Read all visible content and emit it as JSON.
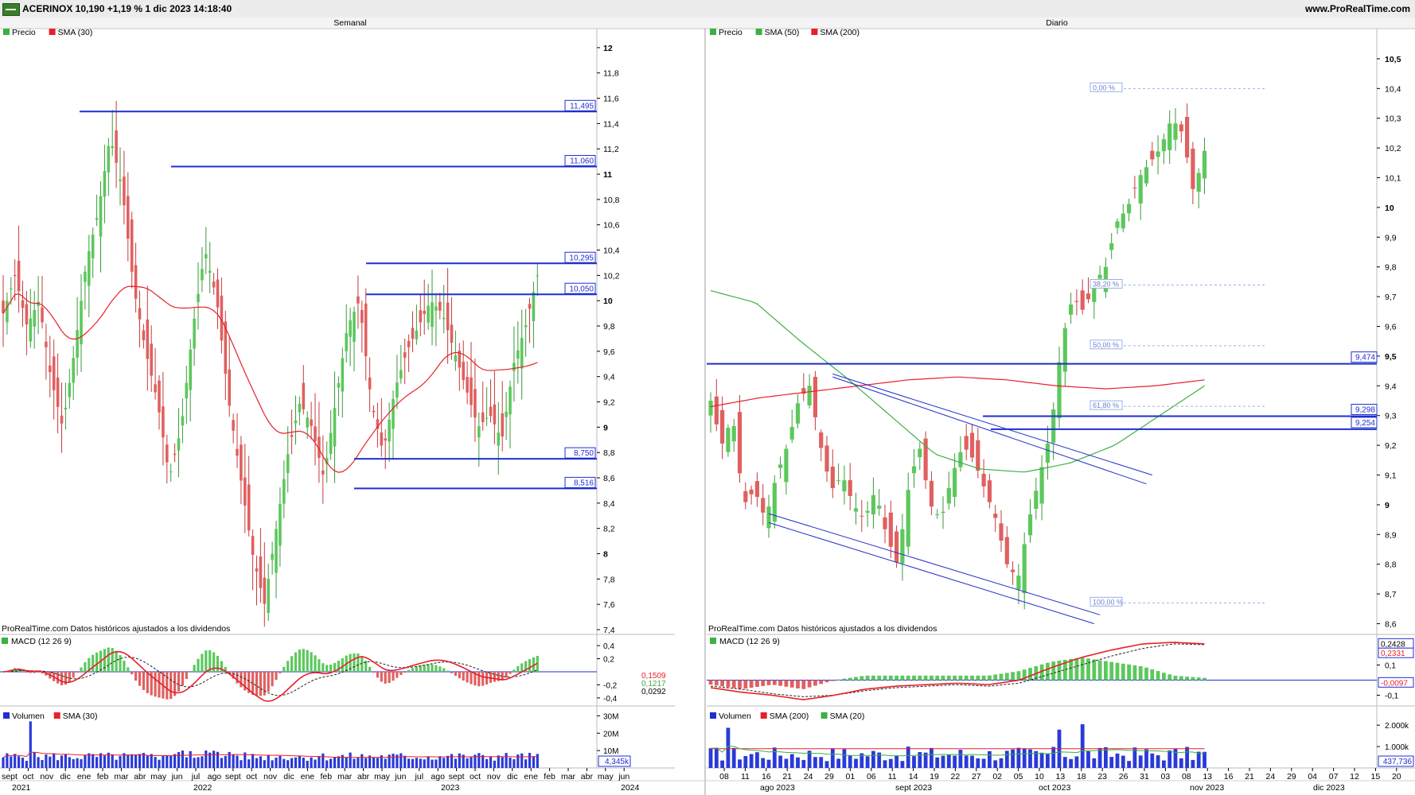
{
  "header": {
    "ticker": "ACERINOX 10,190 +1,19 % 1 dic 2023 14:18:40",
    "site": "www.ProRealTime.com"
  },
  "weekly": {
    "title": "Semanal",
    "legend": [
      "Precio",
      "SMA (30)"
    ],
    "source_note": "ProRealTime.com  Datos históricos ajustados a los dividendos",
    "macd_label": "MACD (12 26 9)",
    "volume_legend": [
      "Volumen",
      "SMA (30)"
    ],
    "price_ticks": [
      "12",
      "11,8",
      "11,6",
      "11,4",
      "11,2",
      "11",
      "10,8",
      "10,6",
      "10,4",
      "10,2",
      "10",
      "9,8",
      "9,6",
      "9,4",
      "9,2",
      "9",
      "8,8",
      "8,6",
      "8,4",
      "8,2",
      "8",
      "7,8",
      "7,6",
      "7,4"
    ],
    "level_tags": [
      "11,495",
      "11,060",
      "10,295",
      "10,050",
      "8,750",
      "8,516"
    ],
    "macd_ticks": [
      "0,4",
      "0,2",
      "-0,2",
      "-0,4"
    ],
    "macd_tags": [
      "0,1509",
      "0,1217",
      "0,0292"
    ],
    "volume_ticks": [
      "30M",
      "20M",
      "10M"
    ],
    "volume_tag": "4,345k",
    "month_labels": [
      "sept",
      "oct",
      "nov",
      "dic",
      "ene",
      "feb",
      "mar",
      "abr",
      "may",
      "jun",
      "jul",
      "ago",
      "sept",
      "oct",
      "nov",
      "dic",
      "ene",
      "feb",
      "mar",
      "abr",
      "may",
      "jun",
      "jul",
      "ago",
      "sept",
      "oct",
      "nov",
      "dic",
      "ene",
      "feb",
      "mar",
      "abr",
      "may",
      "jun"
    ],
    "year_labels": [
      "2021",
      "2022",
      "2023",
      "2024"
    ]
  },
  "daily": {
    "title": "Diario",
    "legend": [
      "Precio",
      "SMA (50)",
      "SMA (200)"
    ],
    "source_note": "ProRealTime.com  Datos históricos ajustados a los dividendos",
    "macd_label": "MACD (12 26 9)",
    "volume_legend": [
      "Volumen",
      "SMA (200)",
      "SMA (20)"
    ],
    "price_ticks": [
      "10,5",
      "10,4",
      "10,3",
      "10,2",
      "10,1",
      "10",
      "9,9",
      "9,8",
      "9,7",
      "9,6",
      "9,5",
      "9,4",
      "9,3",
      "9,2",
      "9,1",
      "9",
      "8,9",
      "8,8",
      "8,7",
      "8,6"
    ],
    "level_tags": [
      "9,474",
      "9,298",
      "9,254"
    ],
    "fib_labels": [
      "0,00 %",
      "38,20 %",
      "50,00 %",
      "61,80 %",
      "100,00 %"
    ],
    "macd_ticks": [
      "0,1",
      "-0,1"
    ],
    "macd_tags": [
      "0,2428",
      "0,2331",
      "-0,0097"
    ],
    "volume_ticks": [
      "2.000k",
      "1.000k"
    ],
    "volume_tag": "437,736",
    "day_labels": [
      "08",
      "11",
      "16",
      "21",
      "24",
      "29",
      "01",
      "06",
      "11",
      "14",
      "19",
      "22",
      "27",
      "02",
      "05",
      "10",
      "13",
      "18",
      "23",
      "26",
      "31",
      "03",
      "08",
      "13",
      "16",
      "21",
      "24",
      "29",
      "04",
      "07",
      "12",
      "15",
      "20"
    ],
    "month_labels": [
      "ago 2023",
      "sept 2023",
      "oct 2023",
      "nov 2023",
      "dic 2023"
    ]
  },
  "chart_data": [
    {
      "type": "candlestick",
      "title": "Semanal",
      "price_range": [
        7.4,
        12.1
      ],
      "series": [
        {
          "name": "Precio"
        },
        {
          "name": "SMA (30)",
          "color": "#e8202a"
        }
      ],
      "horizontal_levels": [
        11.495,
        11.06,
        10.295,
        10.05,
        8.75,
        8.516
      ],
      "x_range": [
        "2021-09",
        "2024-06"
      ],
      "closes": [
        9.9,
        10.2,
        9.8,
        10.0,
        9.4,
        9.0,
        9.6,
        10.3,
        10.7,
        11.3,
        10.9,
        10.1,
        9.6,
        9.2,
        8.6,
        9.0,
        9.8,
        10.4,
        10.0,
        9.2,
        8.6,
        8.0,
        7.6,
        8.2,
        8.8,
        9.2,
        9.0,
        8.6,
        9.2,
        9.8,
        10.0,
        9.2,
        8.8,
        9.3,
        9.6,
        9.8,
        10.0,
        9.9,
        9.6,
        9.3,
        9.0,
        9.1,
        8.9,
        9.5,
        9.8,
        10.2
      ],
      "macd": {
        "values": [
          0.1509,
          0.1217,
          0.0292
        ],
        "range": [
          -0.45,
          0.45
        ]
      },
      "volume": {
        "tag": 4345,
        "unit": "k"
      }
    },
    {
      "type": "candlestick",
      "title": "Diario",
      "price_range": [
        8.58,
        10.58
      ],
      "series": [
        {
          "name": "Precio"
        },
        {
          "name": "SMA (50)",
          "color": "#3cb043"
        },
        {
          "name": "SMA (200)",
          "color": "#e8202a"
        }
      ],
      "horizontal_levels": [
        9.474,
        9.298,
        9.254
      ],
      "fibonacci": {
        "levels_pct": [
          0,
          38.2,
          50,
          61.8,
          100
        ],
        "high": 10.4,
        "low": 8.67
      },
      "closes": [
        9.35,
        9.2,
        9.3,
        9.0,
        9.05,
        8.95,
        9.1,
        9.2,
        9.35,
        9.4,
        9.2,
        9.05,
        9.1,
        9.0,
        8.95,
        9.05,
        8.9,
        8.8,
        9.05,
        9.2,
        9.0,
        8.95,
        9.1,
        9.2,
        9.15,
        9.05,
        8.95,
        8.8,
        8.75,
        8.95,
        9.1,
        9.25,
        9.55,
        9.7,
        9.65,
        9.75,
        9.8,
        9.95,
        10.0,
        10.1,
        10.15,
        10.2,
        10.3,
        10.25,
        10.05,
        10.19
      ],
      "macd": {
        "values": [
          0.2428,
          0.2331,
          -0.0097
        ],
        "range": [
          -0.15,
          0.25
        ]
      },
      "volume": {
        "tag": 437736,
        "ticks_k": [
          1000,
          2000
        ]
      }
    }
  ]
}
